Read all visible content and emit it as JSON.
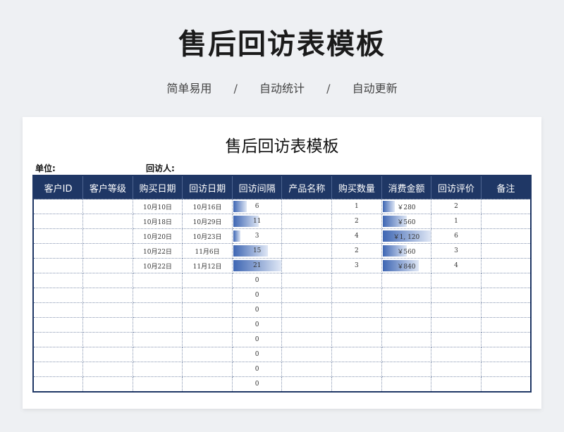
{
  "hero": {
    "title": "售后回访表模板",
    "tags": [
      "简单易用",
      "自动统计",
      "自动更新"
    ],
    "separator": "/"
  },
  "sheet": {
    "title": "售后回访表模板",
    "unit_label": "单位:",
    "visitor_label": "回访人:"
  },
  "table": {
    "headers": [
      "客户ID",
      "客户等级",
      "购买日期",
      "回访日期",
      "回访间隔",
      "产品名称",
      "购买数量",
      "消费金额",
      "回访评价",
      "备注"
    ],
    "rows": [
      {
        "buy_date": "10月10日",
        "visit_date": "10月16日",
        "interval": "6",
        "qty": "1",
        "amount": "￥280",
        "amount_value": 280,
        "rating": "2"
      },
      {
        "buy_date": "10月18日",
        "visit_date": "10月29日",
        "interval": "11",
        "qty": "2",
        "amount": "￥560",
        "amount_value": 560,
        "rating": "1"
      },
      {
        "buy_date": "10月20日",
        "visit_date": "10月23日",
        "interval": "3",
        "qty": "4",
        "amount": "￥1, 120",
        "amount_value": 1120,
        "rating": "6"
      },
      {
        "buy_date": "10月22日",
        "visit_date": "11月6日",
        "interval": "15",
        "qty": "2",
        "amount": "￥560",
        "amount_value": 560,
        "rating": "3"
      },
      {
        "buy_date": "10月22日",
        "visit_date": "11月12日",
        "interval": "21",
        "qty": "3",
        "amount": "￥840",
        "amount_value": 840,
        "rating": "4"
      },
      {
        "interval": "0"
      },
      {
        "interval": "0"
      },
      {
        "interval": "0"
      },
      {
        "interval": "0"
      },
      {
        "interval": "0"
      },
      {
        "interval": "0"
      },
      {
        "interval": "0"
      },
      {
        "interval": "0"
      }
    ],
    "interval_max": 21,
    "amount_max": 1120,
    "bar_color": "#3e66b3",
    "header_color": "#1f3765"
  }
}
